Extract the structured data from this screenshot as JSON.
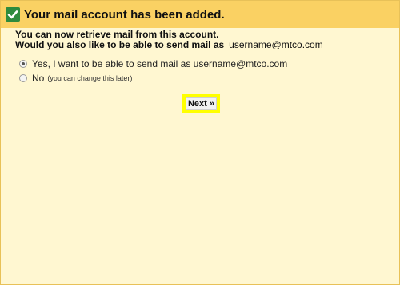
{
  "banner": {
    "title": "Your mail account has been added.",
    "icon": "checkmark-icon",
    "accent_color": "#fad163",
    "check_color": "#2e8b3e"
  },
  "intro": {
    "line1": "You can now retrieve mail from this account.",
    "line2_label": "Would you also like to be able to send mail as",
    "line2_email": "username@mtco.com"
  },
  "options": {
    "yes": {
      "label": "Yes, I want to be able to send mail as username@mtco.com",
      "checked": true
    },
    "no": {
      "label": "No",
      "hint": "(you can change this later)",
      "checked": false
    }
  },
  "actions": {
    "next_label": "Next »",
    "highlight_color": "#ffff00"
  },
  "page": {
    "background_color": "#fff7d1"
  }
}
